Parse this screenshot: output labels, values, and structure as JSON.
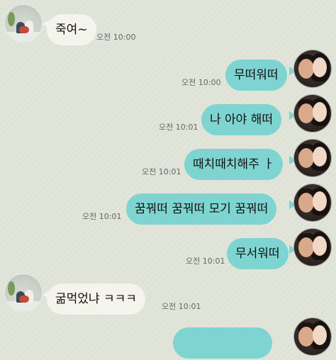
{
  "messages": [
    {
      "sender": "other",
      "text": "죽여~",
      "time": "오전 10:00"
    },
    {
      "sender": "me",
      "text": "무떠워떠",
      "time": "오전 10:00"
    },
    {
      "sender": "me",
      "text": "나 아야 해떠",
      "time": "오전 10:01"
    },
    {
      "sender": "me",
      "text": "때치때치해주 ㅏ",
      "time": "오전 10:01"
    },
    {
      "sender": "me",
      "text": "꿈꿔떠 꿈꿔떠 모기 꿈꿔떠",
      "time": "오전 10:01"
    },
    {
      "sender": "me",
      "text": "무서워떠",
      "time": "오전 10:01"
    },
    {
      "sender": "other",
      "text": "굶먹었냐 ㅋㅋㅋ",
      "time": "오전 10:01"
    }
  ],
  "colors": {
    "my_bubble": "#7ed4d1",
    "their_bubble": "#f4f4ec",
    "background": "#dfe3d7"
  }
}
